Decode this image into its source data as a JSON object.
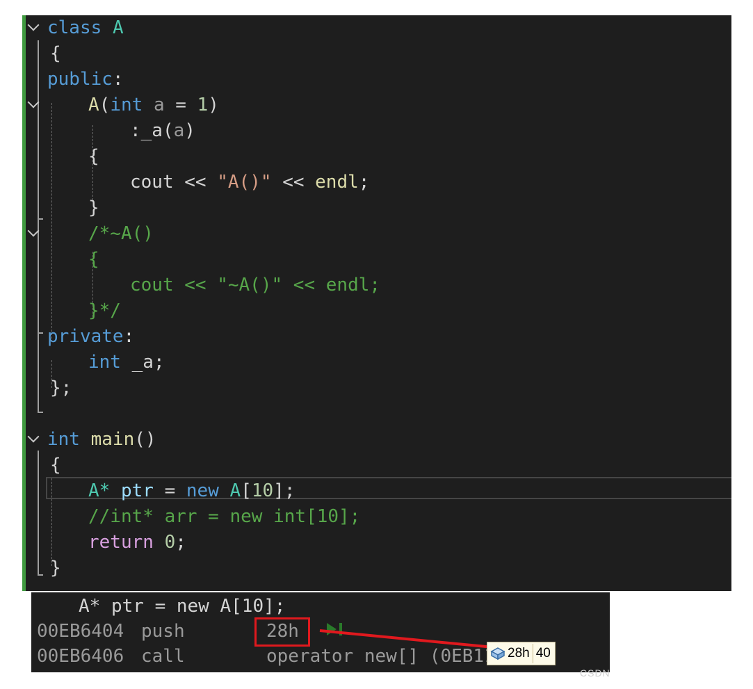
{
  "editor": {
    "fold_lines": [
      "class_A",
      "ctor_A",
      "dtor_comment",
      "main"
    ],
    "lines": {
      "l1": {
        "kw": "class",
        "name": "A"
      },
      "l2": {
        "brace": "{"
      },
      "l3": {
        "kw": "public",
        "colon": ":"
      },
      "l4": {
        "fn": "A",
        "open": "(",
        "kw": "int",
        "param": "a",
        "eq": "=",
        "num": "1",
        "close": ")"
      },
      "l5": {
        "colon": ":",
        "member": "_a",
        "open": "(",
        "param": "a",
        "close": ")"
      },
      "l6": {
        "brace": "{"
      },
      "l7": {
        "var": "cout",
        "op1": "<<",
        "str": "\"A()\"",
        "op2": "<<",
        "fn": "endl",
        "semi": ";"
      },
      "l8": {
        "brace": "}"
      },
      "l9": {
        "comment": "/*~A()"
      },
      "l10": {
        "comment": "{"
      },
      "l11": {
        "comment": "cout << \"~A()\" << endl;"
      },
      "l12": {
        "comment": "}*/"
      },
      "l13": {
        "kw": "private",
        "colon": ":"
      },
      "l14": {
        "kw": "int",
        "member": "_a",
        "semi": ";"
      },
      "l15": {
        "text": "};"
      },
      "l16": {
        "kw": "int",
        "fn": "main",
        "parens": "()"
      },
      "l17": {
        "brace": "{"
      },
      "l18": {
        "ty": "A*",
        "var": "ptr",
        "eq": "=",
        "kw": "new",
        "ty2": "A",
        "open": "[",
        "num": "10",
        "close": "]",
        "semi": ";"
      },
      "l19": {
        "comment": "//int* arr = new int[10];"
      },
      "l20": {
        "ctrl": "return",
        "num": "0",
        "semi": ";"
      },
      "l21": {
        "brace": "}"
      }
    }
  },
  "disassembly": {
    "source_line": "A* ptr = new A[10];",
    "rows": [
      {
        "address": "00EB6404",
        "mnemonic": "push",
        "operand": "28h"
      },
      {
        "address": "00EB6406",
        "mnemonic": "call",
        "operand": "operator new[] (0EB11"
      }
    ]
  },
  "tooltip": {
    "hex": "28h",
    "dec": "40"
  },
  "watermark": "CSDN",
  "colors": {
    "keyword": "#569cd6",
    "type": "#4ec9b0",
    "function": "#dcdcaa",
    "string": "#d69d85",
    "number": "#b5cea8",
    "variable": "#9cdcfe",
    "control": "#d8a0df",
    "comment": "#57a64a",
    "highlight": "#e0191e"
  }
}
